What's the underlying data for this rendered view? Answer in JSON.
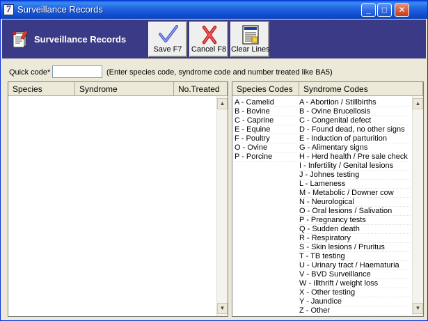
{
  "window": {
    "title": "Surveillance Records",
    "icon_glyph": "7"
  },
  "titlebar_buttons": {
    "minimize": "_",
    "maximize": "□",
    "close": "✕"
  },
  "header": {
    "title": "Surveillance Records",
    "buttons": [
      {
        "label": "Save F7",
        "icon": "check-icon"
      },
      {
        "label": "Cancel F8",
        "icon": "x-icon"
      },
      {
        "label": "Clear Lines",
        "icon": "clear-lines-icon"
      }
    ]
  },
  "quick_code": {
    "label": "Quick code*",
    "value": "",
    "hint": "(Enter species code, syndrome code and number treated like BA5)"
  },
  "records_table": {
    "columns": [
      "Species",
      "Syndrome",
      "No.Treated"
    ],
    "rows": []
  },
  "codes_table": {
    "columns": [
      "Species Codes",
      "Syndrome Codes"
    ],
    "species_codes": [
      "A - Camelid",
      "B - Bovine",
      "C - Caprine",
      "E - Equine",
      "F - Poultry",
      "O - Ovine",
      "P - Porcine"
    ],
    "syndrome_codes": [
      "A - Abortion / Stillbirths",
      "B - Ovine Brucellosis",
      "C - Congenital defect",
      "D - Found dead, no other signs",
      "E - Induction of parturition",
      "G - Alimentary signs",
      "H - Herd health / Pre sale check",
      "I - Infertility / Genital lesions",
      "J - Johnes testing",
      "L - Lameness",
      "M - Metabolic / Downer cow",
      "N - Neurological",
      "O - Oral lesions / Salivation",
      "P - Pregnancy tests",
      "Q - Sudden death",
      "R - Respiratory",
      "S - Skin lesions / Pruritus",
      "T - TB testing",
      "U - Urinary tract / Haematuria",
      "V - BVD Surveillance",
      "W - Illthrift / weight loss",
      "X - Other testing",
      "Y - Jaundice",
      "Z - Other"
    ]
  },
  "scroll": {
    "up": "▲",
    "down": "▼"
  }
}
